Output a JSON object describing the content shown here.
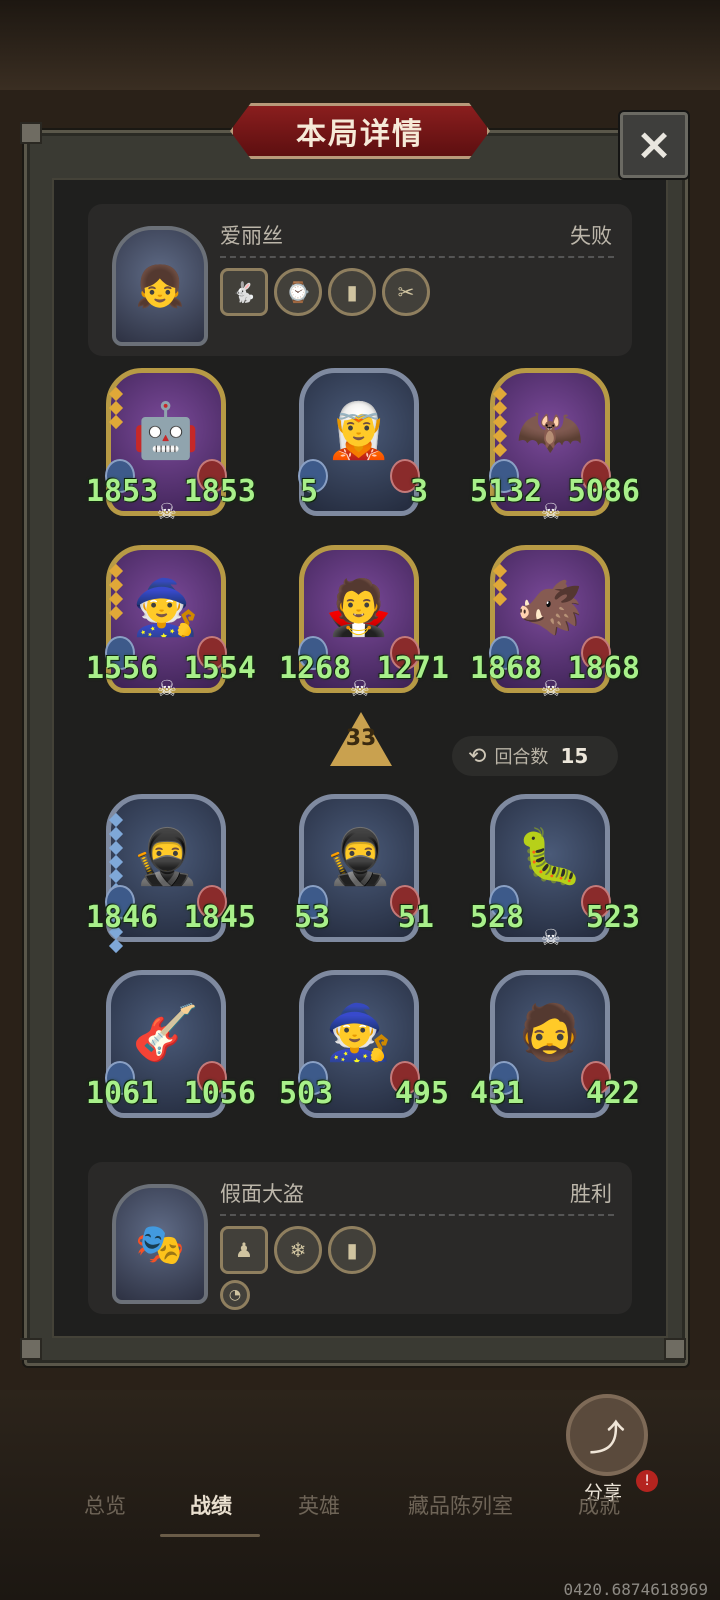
{
  "title": "本局详情",
  "close_icon": "×",
  "players": {
    "top": {
      "name": "爱丽丝",
      "result": "失败",
      "portrait_icon": "alice-portrait",
      "items": [
        "🐇",
        "⌚",
        "▮",
        "✂"
      ]
    },
    "bottom": {
      "name": "假面大盗",
      "result": "胜利",
      "portrait_icon": "masked-thief-portrait",
      "items": [
        "♟",
        "❄",
        "▮"
      ],
      "extra_item": "◔"
    }
  },
  "enemy_units": [
    {
      "icon": "🤖",
      "atk": "1853",
      "hp": "1853",
      "frame": "gold"
    },
    {
      "icon": "🧝",
      "atk": "5",
      "hp": "3",
      "frame": "silver"
    },
    {
      "icon": "🦇",
      "atk": "5132",
      "hp": "5086",
      "frame": "gold"
    },
    {
      "icon": "🧙",
      "atk": "1556",
      "hp": "1554",
      "frame": "gold"
    },
    {
      "icon": "🧛",
      "atk": "1268",
      "hp": "1271",
      "frame": "gold"
    },
    {
      "icon": "🐗",
      "atk": "1868",
      "hp": "1868",
      "frame": "gold"
    }
  ],
  "player_units": [
    {
      "icon": "🥷",
      "atk": "1846",
      "hp": "1845",
      "frame": "silver"
    },
    {
      "icon": "🥷",
      "atk": "53",
      "hp": "51",
      "frame": "silver"
    },
    {
      "icon": "🐛",
      "atk": "528",
      "hp": "523",
      "frame": "silver"
    },
    {
      "icon": "🎸",
      "atk": "1061",
      "hp": "1056",
      "frame": "silver"
    },
    {
      "icon": "🧙",
      "atk": "503",
      "hp": "495",
      "frame": "silver"
    },
    {
      "icon": "🧔",
      "atk": "431",
      "hp": "422",
      "frame": "silver"
    }
  ],
  "rank_value": "33",
  "round": {
    "label": "回合数",
    "value": "15",
    "icon": "⟲"
  },
  "share": {
    "label": "分享",
    "icon": "⤴",
    "alert": "!"
  },
  "tabs": [
    "总览",
    "战绩",
    "英雄",
    "藏品陈列室",
    "成就"
  ],
  "active_tab": "战绩",
  "build_id": "0420.6874618969"
}
